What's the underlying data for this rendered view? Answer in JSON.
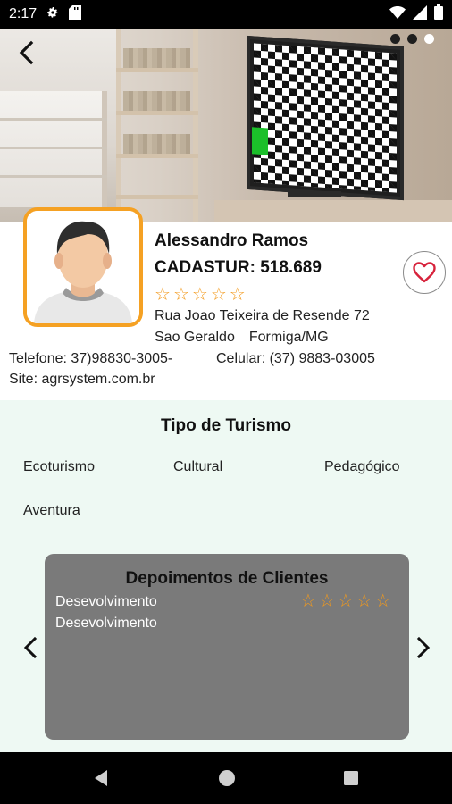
{
  "status_bar": {
    "time": "2:17",
    "icons": [
      "gear-icon",
      "sd-card-icon",
      "wifi-icon",
      "signal-icon",
      "battery-icon"
    ]
  },
  "hero": {
    "carousel_dots": 3,
    "active_dot": 2,
    "back_icon": "chevron-left-icon"
  },
  "profile": {
    "name": "Alessandro Ramos",
    "cadastur": "CADASTUR: 518.689",
    "rating": 0,
    "rating_max": 5,
    "address_line1": "Rua Joao Teixeira de Resende 72",
    "neighborhood": "Sao Geraldo",
    "city": "Formiga/MG",
    "phone": "Telefone: 37)98830-3005-",
    "cell": "Celular: (37) 9883-03005",
    "site": "Site: agrsystem.com.br",
    "favorite_icon": "heart-outline-icon"
  },
  "tourism": {
    "title": "Tipo de Turismo",
    "types": [
      "Ecoturismo",
      "Cultural",
      "Pedagógico",
      "Aventura"
    ]
  },
  "testimonials": {
    "title": "Depoimentos de Clientes",
    "text_line1": "Desevolvimento",
    "text_line2": "Desevolvimento",
    "rating": 0,
    "rating_max": 5,
    "prev_icon": "chevron-left-icon",
    "next_icon": "chevron-right-icon"
  },
  "nav_bar": {
    "buttons": [
      "back-triangle-icon",
      "home-circle-icon",
      "recents-square-icon"
    ]
  },
  "colors": {
    "accent_orange": "#f5a123",
    "star_orange": "#f39a1c",
    "tourism_bg": "#eef9f3",
    "testimonial_bg": "#7a7a7a"
  }
}
